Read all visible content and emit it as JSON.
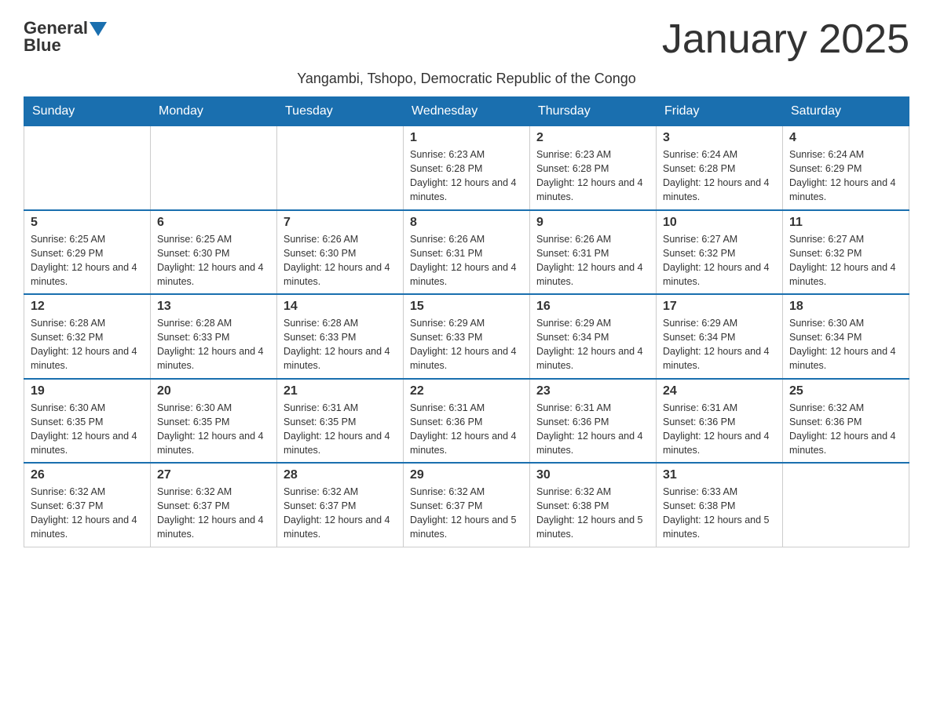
{
  "logo": {
    "general": "General",
    "blue": "Blue",
    "arrow": "▼"
  },
  "title": "January 2025",
  "subtitle": "Yangambi, Tshopo, Democratic Republic of the Congo",
  "days_header": [
    "Sunday",
    "Monday",
    "Tuesday",
    "Wednesday",
    "Thursday",
    "Friday",
    "Saturday"
  ],
  "weeks": [
    [
      {
        "day": "",
        "info": ""
      },
      {
        "day": "",
        "info": ""
      },
      {
        "day": "",
        "info": ""
      },
      {
        "day": "1",
        "info": "Sunrise: 6:23 AM\nSunset: 6:28 PM\nDaylight: 12 hours and 4 minutes."
      },
      {
        "day": "2",
        "info": "Sunrise: 6:23 AM\nSunset: 6:28 PM\nDaylight: 12 hours and 4 minutes."
      },
      {
        "day": "3",
        "info": "Sunrise: 6:24 AM\nSunset: 6:28 PM\nDaylight: 12 hours and 4 minutes."
      },
      {
        "day": "4",
        "info": "Sunrise: 6:24 AM\nSunset: 6:29 PM\nDaylight: 12 hours and 4 minutes."
      }
    ],
    [
      {
        "day": "5",
        "info": "Sunrise: 6:25 AM\nSunset: 6:29 PM\nDaylight: 12 hours and 4 minutes."
      },
      {
        "day": "6",
        "info": "Sunrise: 6:25 AM\nSunset: 6:30 PM\nDaylight: 12 hours and 4 minutes."
      },
      {
        "day": "7",
        "info": "Sunrise: 6:26 AM\nSunset: 6:30 PM\nDaylight: 12 hours and 4 minutes."
      },
      {
        "day": "8",
        "info": "Sunrise: 6:26 AM\nSunset: 6:31 PM\nDaylight: 12 hours and 4 minutes."
      },
      {
        "day": "9",
        "info": "Sunrise: 6:26 AM\nSunset: 6:31 PM\nDaylight: 12 hours and 4 minutes."
      },
      {
        "day": "10",
        "info": "Sunrise: 6:27 AM\nSunset: 6:32 PM\nDaylight: 12 hours and 4 minutes."
      },
      {
        "day": "11",
        "info": "Sunrise: 6:27 AM\nSunset: 6:32 PM\nDaylight: 12 hours and 4 minutes."
      }
    ],
    [
      {
        "day": "12",
        "info": "Sunrise: 6:28 AM\nSunset: 6:32 PM\nDaylight: 12 hours and 4 minutes."
      },
      {
        "day": "13",
        "info": "Sunrise: 6:28 AM\nSunset: 6:33 PM\nDaylight: 12 hours and 4 minutes."
      },
      {
        "day": "14",
        "info": "Sunrise: 6:28 AM\nSunset: 6:33 PM\nDaylight: 12 hours and 4 minutes."
      },
      {
        "day": "15",
        "info": "Sunrise: 6:29 AM\nSunset: 6:33 PM\nDaylight: 12 hours and 4 minutes."
      },
      {
        "day": "16",
        "info": "Sunrise: 6:29 AM\nSunset: 6:34 PM\nDaylight: 12 hours and 4 minutes."
      },
      {
        "day": "17",
        "info": "Sunrise: 6:29 AM\nSunset: 6:34 PM\nDaylight: 12 hours and 4 minutes."
      },
      {
        "day": "18",
        "info": "Sunrise: 6:30 AM\nSunset: 6:34 PM\nDaylight: 12 hours and 4 minutes."
      }
    ],
    [
      {
        "day": "19",
        "info": "Sunrise: 6:30 AM\nSunset: 6:35 PM\nDaylight: 12 hours and 4 minutes."
      },
      {
        "day": "20",
        "info": "Sunrise: 6:30 AM\nSunset: 6:35 PM\nDaylight: 12 hours and 4 minutes."
      },
      {
        "day": "21",
        "info": "Sunrise: 6:31 AM\nSunset: 6:35 PM\nDaylight: 12 hours and 4 minutes."
      },
      {
        "day": "22",
        "info": "Sunrise: 6:31 AM\nSunset: 6:36 PM\nDaylight: 12 hours and 4 minutes."
      },
      {
        "day": "23",
        "info": "Sunrise: 6:31 AM\nSunset: 6:36 PM\nDaylight: 12 hours and 4 minutes."
      },
      {
        "day": "24",
        "info": "Sunrise: 6:31 AM\nSunset: 6:36 PM\nDaylight: 12 hours and 4 minutes."
      },
      {
        "day": "25",
        "info": "Sunrise: 6:32 AM\nSunset: 6:36 PM\nDaylight: 12 hours and 4 minutes."
      }
    ],
    [
      {
        "day": "26",
        "info": "Sunrise: 6:32 AM\nSunset: 6:37 PM\nDaylight: 12 hours and 4 minutes."
      },
      {
        "day": "27",
        "info": "Sunrise: 6:32 AM\nSunset: 6:37 PM\nDaylight: 12 hours and 4 minutes."
      },
      {
        "day": "28",
        "info": "Sunrise: 6:32 AM\nSunset: 6:37 PM\nDaylight: 12 hours and 4 minutes."
      },
      {
        "day": "29",
        "info": "Sunrise: 6:32 AM\nSunset: 6:37 PM\nDaylight: 12 hours and 5 minutes."
      },
      {
        "day": "30",
        "info": "Sunrise: 6:32 AM\nSunset: 6:38 PM\nDaylight: 12 hours and 5 minutes."
      },
      {
        "day": "31",
        "info": "Sunrise: 6:33 AM\nSunset: 6:38 PM\nDaylight: 12 hours and 5 minutes."
      },
      {
        "day": "",
        "info": ""
      }
    ]
  ]
}
